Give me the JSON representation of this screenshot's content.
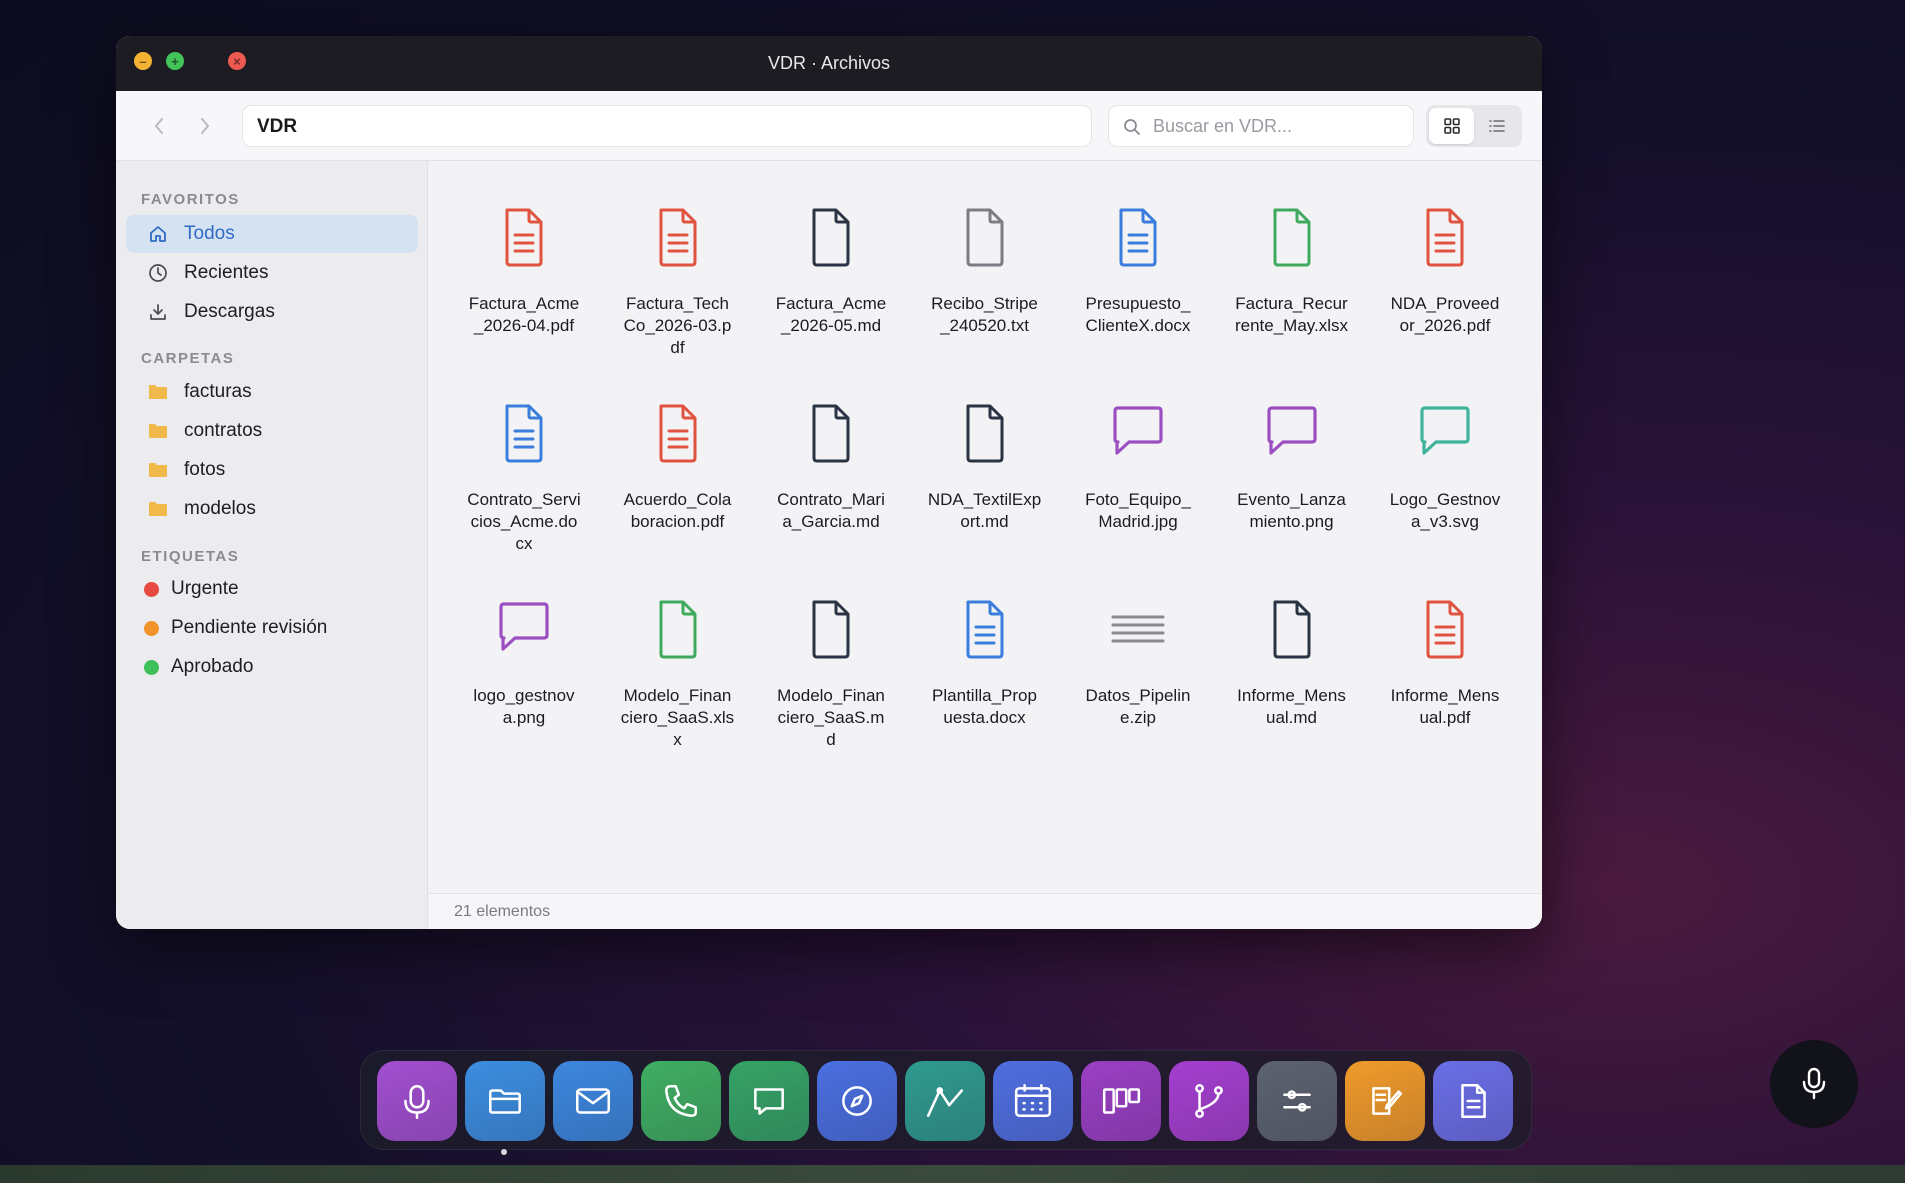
{
  "window": {
    "title": "VDR · Archivos",
    "traffic": {
      "minimize": "–",
      "maximize": "+",
      "close": "×"
    }
  },
  "toolbar": {
    "back_icon": "chevron-left-icon",
    "forward_icon": "chevron-right-icon",
    "path": "VDR",
    "search_placeholder": "Buscar en VDR...",
    "view_modes": [
      "grid",
      "list"
    ],
    "active_view": "grid"
  },
  "sidebar": {
    "favorites_header": "FAVORITOS",
    "favorites": [
      {
        "label": "Todos",
        "icon": "home-icon",
        "active": true
      },
      {
        "label": "Recientes",
        "icon": "clock-icon",
        "active": false
      },
      {
        "label": "Descargas",
        "icon": "download-icon",
        "active": false
      }
    ],
    "folders_header": "CARPETAS",
    "folders": [
      {
        "label": "facturas",
        "icon": "folder-icon"
      },
      {
        "label": "contratos",
        "icon": "folder-icon"
      },
      {
        "label": "fotos",
        "icon": "folder-icon"
      },
      {
        "label": "modelos",
        "icon": "folder-icon"
      }
    ],
    "tags_header": "ETIQUETAS",
    "tags": [
      {
        "label": "Urgente",
        "color": "#e5493f"
      },
      {
        "label": "Pendiente revisión",
        "color": "#f0932b"
      },
      {
        "label": "Aprobado",
        "color": "#3fbf5a"
      }
    ]
  },
  "files": [
    {
      "name": "Factura_Acme_2026-04.pdf",
      "kind": "doc-lines",
      "color": "#e0533f"
    },
    {
      "name": "Factura_TechCo_2026-03.pdf",
      "kind": "doc-lines",
      "color": "#e0533f"
    },
    {
      "name": "Factura_Acme_2026-05.md",
      "kind": "doc-blank",
      "color": "#2b3444"
    },
    {
      "name": "Recibo_Stripe_240520.txt",
      "kind": "doc-blank",
      "color": "#7c7c84"
    },
    {
      "name": "Presupuesto_ClienteX.docx",
      "kind": "doc-lines",
      "color": "#3b7ddd"
    },
    {
      "name": "Factura_Recurrente_May.xlsx",
      "kind": "doc-blank",
      "color": "#3faa5e"
    },
    {
      "name": "NDA_Proveedor_2026.pdf",
      "kind": "doc-lines",
      "color": "#e0533f"
    },
    {
      "name": "Contrato_Servicios_Acme.docx",
      "kind": "doc-lines",
      "color": "#3b7ddd"
    },
    {
      "name": "Acuerdo_Colaboracion.pdf",
      "kind": "doc-lines",
      "color": "#e0533f"
    },
    {
      "name": "Contrato_Maria_Garcia.md",
      "kind": "doc-blank",
      "color": "#2b3444"
    },
    {
      "name": "NDA_TextilExport.md",
      "kind": "doc-blank",
      "color": "#2b3444"
    },
    {
      "name": "Foto_Equipo_Madrid.jpg",
      "kind": "bubble",
      "color": "#9b4fc2"
    },
    {
      "name": "Evento_Lanzamiento.png",
      "kind": "bubble",
      "color": "#9b4fc2"
    },
    {
      "name": "Logo_Gestnova_v3.svg",
      "kind": "bubble",
      "color": "#3fb49a"
    },
    {
      "name": "logo_gestnova.png",
      "kind": "bubble",
      "color": "#9b4fc2"
    },
    {
      "name": "Modelo_Financiero_SaaS.xlsx",
      "kind": "doc-blank",
      "color": "#3faa5e"
    },
    {
      "name": "Modelo_Financiero_SaaS.md",
      "kind": "doc-blank",
      "color": "#2b3444"
    },
    {
      "name": "Plantilla_Propuesta.docx",
      "kind": "doc-lines",
      "color": "#3b7ddd"
    },
    {
      "name": "Datos_Pipeline.zip",
      "kind": "lines",
      "color": "#8a8a90"
    },
    {
      "name": "Informe_Mensual.md",
      "kind": "doc-blank",
      "color": "#2b3444"
    },
    {
      "name": "Informe_Mensual.pdf",
      "kind": "doc-lines",
      "color": "#e0533f"
    }
  ],
  "status": {
    "count_label": "21 elementos"
  },
  "dock": {
    "apps": [
      {
        "name": "voice",
        "icon": "microphone-icon",
        "color": "#a24fd0"
      },
      {
        "name": "files",
        "icon": "folder-icon",
        "color": "#3c8de0",
        "running": true
      },
      {
        "name": "mail",
        "icon": "mail-icon",
        "color": "#3c87de"
      },
      {
        "name": "phone",
        "icon": "phone-icon",
        "color": "#3fae62"
      },
      {
        "name": "messages",
        "icon": "chat-icon",
        "color": "#35a366"
      },
      {
        "name": "browser",
        "icon": "compass-icon",
        "color": "#4a6fe0"
      },
      {
        "name": "analytics",
        "icon": "chart-line-icon",
        "color": "#2f9a8f"
      },
      {
        "name": "calendar",
        "icon": "calendar-icon",
        "color": "#4f6ee0"
      },
      {
        "name": "kanban",
        "icon": "kanban-icon",
        "color": "#9a3fc4"
      },
      {
        "name": "git",
        "icon": "git-branch-icon",
        "color": "#a43fcf"
      },
      {
        "name": "settings",
        "icon": "sliders-icon",
        "color": "#5b6270"
      },
      {
        "name": "notes",
        "icon": "edit-icon",
        "color": "#f09a2a"
      },
      {
        "name": "documents",
        "icon": "document-icon",
        "color": "#6a6ee6"
      }
    ]
  },
  "floating": {
    "icon": "microphone-icon"
  }
}
